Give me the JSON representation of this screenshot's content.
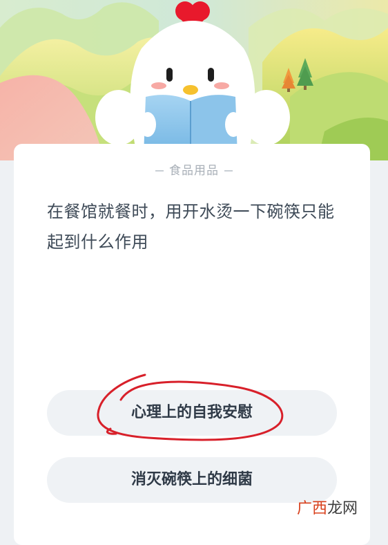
{
  "category": "食品用品",
  "question": "在餐馆就餐时，用开水烫一下碗筷只能起到什么作用",
  "options": [
    {
      "label": "心理上的自我安慰",
      "circled": true
    },
    {
      "label": "消灭碗筷上的细菌",
      "circled": false
    }
  ],
  "watermark": {
    "part1": "广西",
    "part2": "龙网"
  },
  "colors": {
    "circle_annotation": "#d8202a",
    "question_text": "#3e4a57",
    "option_bg": "#eff2f5",
    "mascot_body": "#ffffff",
    "book": "#8cc4ea"
  },
  "icons": [
    "chicken-mascot",
    "open-book",
    "pine-tree"
  ]
}
